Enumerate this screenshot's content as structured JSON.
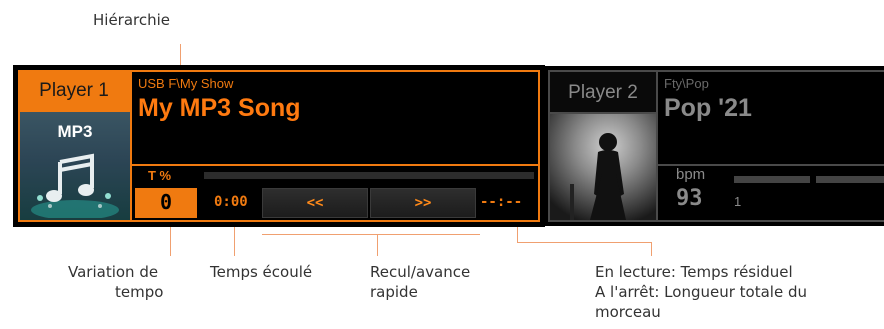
{
  "callouts": {
    "hierarchy": "Hiérarchie",
    "tempo_var_1": "Variation de",
    "tempo_var_2": "tempo",
    "elapsed": "Temps écoulé",
    "ffrew_1": "Recul/avance",
    "ffrew_2": "rapide",
    "remaining_1": "En lecture: Temps résiduel",
    "remaining_2": "A l'arrêt: Longueur totale du",
    "remaining_3": "morceau"
  },
  "player1": {
    "label": "Player 1",
    "format": "MP3",
    "path": "USB F\\My Show",
    "song": "My MP3 Song",
    "tempo_label": "T %",
    "tempo_value": "0",
    "elapsed": "0:00",
    "rewind_label": "<<",
    "forward_label": ">>",
    "remaining": "--:--"
  },
  "player2": {
    "label": "Player 2",
    "path": "Fty\\Pop",
    "song": "Pop '21",
    "bpm_label": "bpm",
    "bpm_value": "93",
    "beat": "1"
  },
  "colors": {
    "accent": "#f07a10",
    "callout_line": "#f0a070",
    "inactive": "#4a4a4a"
  }
}
